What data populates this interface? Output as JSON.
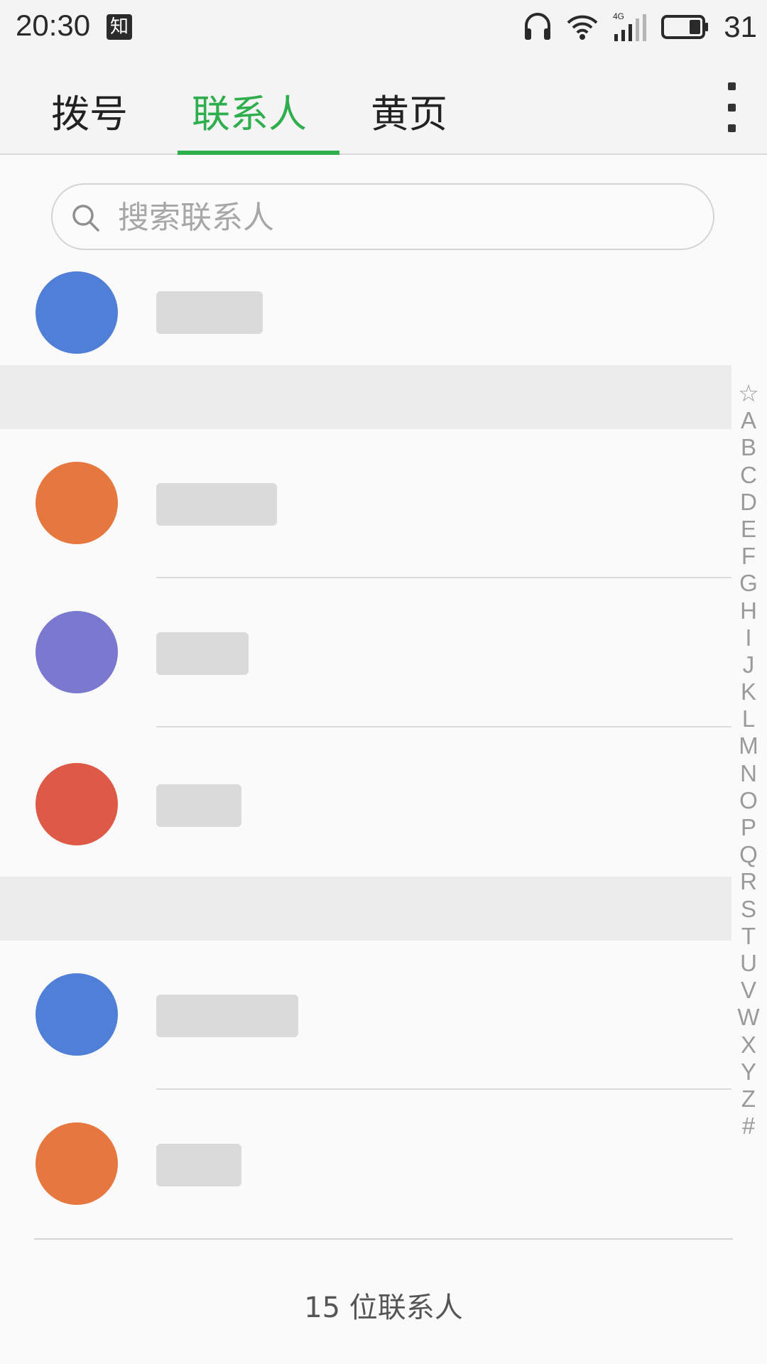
{
  "status_bar": {
    "time": "20:30",
    "app_badge": "知",
    "network_label": "4G",
    "battery_level": "31"
  },
  "tabs": [
    {
      "label": "拨号",
      "active": false
    },
    {
      "label": "联系人",
      "active": true
    },
    {
      "label": "黄页",
      "active": false
    }
  ],
  "search": {
    "placeholder": "搜索联系人",
    "value": ""
  },
  "alphabet_index": [
    "☆",
    "A",
    "B",
    "C",
    "D",
    "E",
    "F",
    "G",
    "H",
    "I",
    "J",
    "K",
    "L",
    "M",
    "N",
    "O",
    "P",
    "Q",
    "R",
    "S",
    "T",
    "U",
    "V",
    "W",
    "X",
    "Y",
    "Z",
    "#"
  ],
  "footer": {
    "count_text": "15 位联系人"
  },
  "colors": {
    "accent": "#2fae4e",
    "avatar_blue": "#4f7fd6",
    "avatar_orange": "#e6773f",
    "avatar_purple": "#7a78cf",
    "avatar_red": "#df5a46"
  }
}
